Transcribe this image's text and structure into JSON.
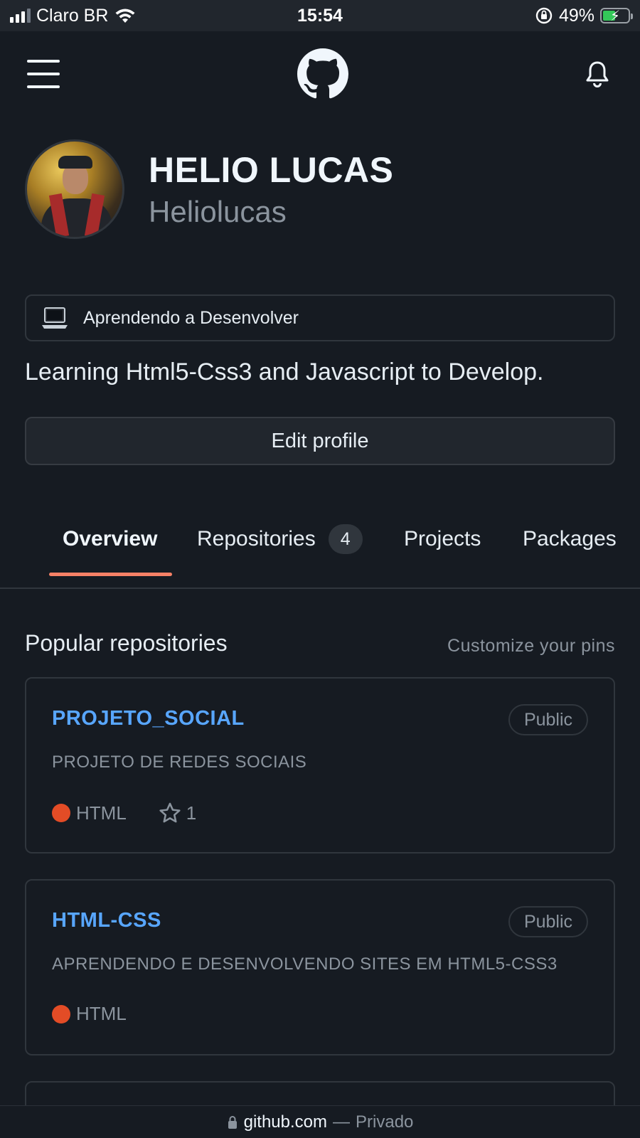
{
  "status_bar": {
    "carrier": "Claro BR",
    "time": "15:54",
    "battery_percent": "49%",
    "battery_level": 0.49,
    "icons": [
      "signal-icon",
      "wifi-icon",
      "orientation-lock-icon",
      "battery-charging-icon"
    ]
  },
  "header": {
    "icons": [
      "hamburger-menu-icon",
      "github-logo-icon",
      "bell-icon"
    ]
  },
  "profile": {
    "display_name": "HELIO LUCAS",
    "username": "Heliolucas",
    "status_text": "Aprendendo a Desenvolver",
    "status_icon": "laptop-icon",
    "bio": "Learning Html5-Css3 and Javascript to Develop.",
    "edit_label": "Edit profile"
  },
  "tabs": [
    {
      "label": "Overview",
      "active": true
    },
    {
      "label": "Repositories",
      "count": "4"
    },
    {
      "label": "Projects"
    },
    {
      "label": "Packages"
    }
  ],
  "popular": {
    "title": "Popular repositories",
    "customize_label": "Customize your pins",
    "repos": [
      {
        "name": "PROJETO_SOCIAL",
        "visibility": "Public",
        "description": "PROJETO DE REDES SOCIAIS",
        "language": "HTML",
        "language_color": "#e34c26",
        "stars": "1"
      },
      {
        "name": "HTML-CSS",
        "visibility": "Public",
        "description": "APRENDENDO E DESENVOLVENDO SITES EM HTML5-CSS3",
        "language": "HTML",
        "language_color": "#e34c26"
      }
    ]
  },
  "url_bar": {
    "host": "github.com",
    "separator": "—",
    "mode": "Privado"
  },
  "colors": {
    "background": "#161b22",
    "link": "#58a6ff",
    "tab_underline": "#f78166",
    "muted": "#8b949e",
    "border": "#30363d"
  }
}
